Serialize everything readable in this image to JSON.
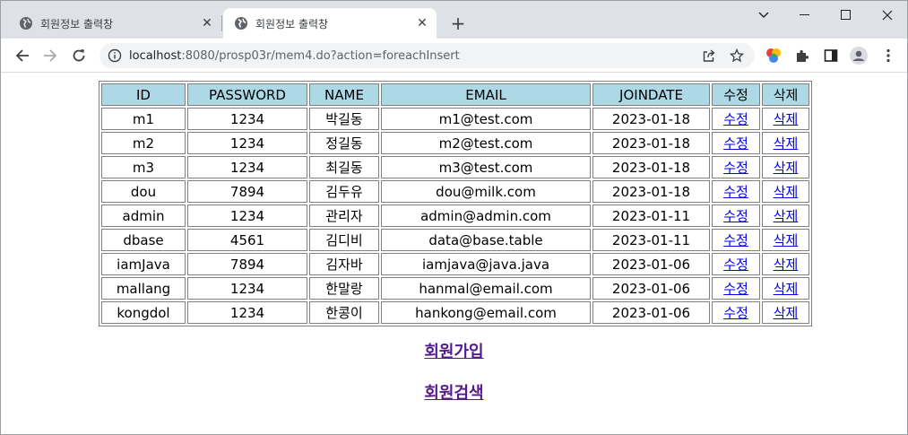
{
  "browser": {
    "tabs": [
      {
        "title": "회원정보 출력창",
        "active": false
      },
      {
        "title": "회원정보 출력창",
        "active": true
      }
    ],
    "new_tab_label": "+",
    "url_host": "localhost",
    "url_rest": ":8080/prosp03r/mem4.do?action=foreachInsert"
  },
  "table": {
    "headers": [
      "ID",
      "PASSWORD",
      "NAME",
      "EMAIL",
      "JOINDATE",
      "수정",
      "삭제"
    ],
    "rows": [
      {
        "id": "m1",
        "pwd": "1234",
        "name": "박길동",
        "email": "m1@test.com",
        "joindate": "2023-01-18",
        "edit": "수정",
        "delete": "삭제"
      },
      {
        "id": "m2",
        "pwd": "1234",
        "name": "정길동",
        "email": "m2@test.com",
        "joindate": "2023-01-18",
        "edit": "수정",
        "delete": "삭제"
      },
      {
        "id": "m3",
        "pwd": "1234",
        "name": "최길동",
        "email": "m3@test.com",
        "joindate": "2023-01-18",
        "edit": "수정",
        "delete": "삭제"
      },
      {
        "id": "dou",
        "pwd": "7894",
        "name": "김두유",
        "email": "dou@milk.com",
        "joindate": "2023-01-18",
        "edit": "수정",
        "delete": "삭제"
      },
      {
        "id": "admin",
        "pwd": "1234",
        "name": "관리자",
        "email": "admin@admin.com",
        "joindate": "2023-01-11",
        "edit": "수정",
        "delete": "삭제"
      },
      {
        "id": "dbase",
        "pwd": "4561",
        "name": "김디비",
        "email": "data@base.table",
        "joindate": "2023-01-11",
        "edit": "수정",
        "delete": "삭제"
      },
      {
        "id": "iamJava",
        "pwd": "7894",
        "name": "김자바",
        "email": "iamjava@java.java",
        "joindate": "2023-01-06",
        "edit": "수정",
        "delete": "삭제"
      },
      {
        "id": "mallang",
        "pwd": "1234",
        "name": "한말랑",
        "email": "hanmal@email.com",
        "joindate": "2023-01-06",
        "edit": "수정",
        "delete": "삭제"
      },
      {
        "id": "kongdol",
        "pwd": "1234",
        "name": "한콩이",
        "email": "hankong@email.com",
        "joindate": "2023-01-06",
        "edit": "수정",
        "delete": "삭제"
      }
    ]
  },
  "links": {
    "join": "회원가입",
    "search": "회원검색"
  },
  "colors": {
    "header_bg": "#add8e6",
    "link": "#0000ee",
    "visited_link": "#551a8b"
  }
}
